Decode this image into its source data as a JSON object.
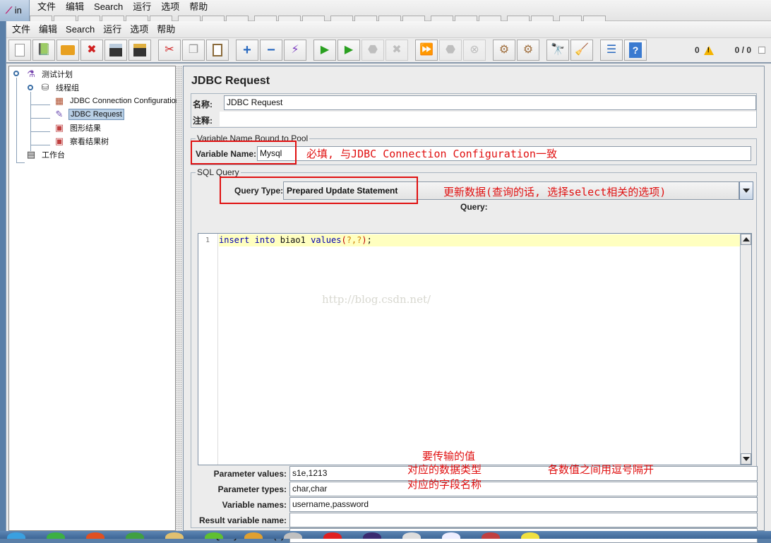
{
  "background_window": {
    "title_fragment": "in",
    "menu": [
      "文件",
      "编辑",
      "Search",
      "运行",
      "选项",
      "帮助"
    ]
  },
  "menubar": {
    "items": [
      "文件",
      "编辑",
      "Search",
      "运行",
      "选项",
      "帮助"
    ]
  },
  "toolbar": {
    "buttons": [
      {
        "name": "new",
        "icon": "new-file-icon"
      },
      {
        "name": "templates",
        "icon": "templates-icon"
      },
      {
        "name": "open",
        "icon": "open-folder-icon"
      },
      {
        "name": "close",
        "icon": "close-file-icon"
      },
      {
        "name": "save",
        "icon": "save-icon"
      },
      {
        "name": "save-as",
        "icon": "save-as-icon"
      },
      {
        "name": "cut",
        "icon": "scissors-icon"
      },
      {
        "name": "copy",
        "icon": "copy-icon"
      },
      {
        "name": "paste",
        "icon": "paste-icon"
      },
      {
        "name": "expand",
        "icon": "plus-icon"
      },
      {
        "name": "collapse",
        "icon": "minus-icon"
      },
      {
        "name": "toggle",
        "icon": "toggle-icon"
      },
      {
        "name": "start",
        "icon": "play-icon"
      },
      {
        "name": "start-no-pauses",
        "icon": "play-no-timers-icon"
      },
      {
        "name": "stop",
        "icon": "stop-icon",
        "disabled": true
      },
      {
        "name": "shutdown",
        "icon": "shutdown-icon",
        "disabled": true
      },
      {
        "name": "remote-start",
        "icon": "remote-start-icon"
      },
      {
        "name": "remote-stop",
        "icon": "remote-stop-icon",
        "disabled": true
      },
      {
        "name": "remote-shutdown",
        "icon": "remote-shutdown-icon",
        "disabled": true
      },
      {
        "name": "clear",
        "icon": "clear-icon"
      },
      {
        "name": "clear-all",
        "icon": "clear-all-icon"
      },
      {
        "name": "search",
        "icon": "binoculars-icon"
      },
      {
        "name": "reset-search",
        "icon": "broom-icon"
      },
      {
        "name": "function-helper",
        "icon": "function-list-icon"
      },
      {
        "name": "help",
        "icon": "help-book-icon"
      }
    ],
    "status": {
      "error_count": "0",
      "threads": "0 / 0"
    }
  },
  "tree": {
    "nodes": [
      {
        "label": "测试计划",
        "icon": "test-plan-flask-icon",
        "level": 0
      },
      {
        "label": "线程组",
        "icon": "thread-group-spool-icon",
        "level": 1
      },
      {
        "label": "JDBC Connection Configuration",
        "icon": "jdbc-config-icon",
        "level": 2
      },
      {
        "label": "JDBC Request",
        "icon": "pipette-sampler-icon",
        "level": 2,
        "selected": true
      },
      {
        "label": "图形结果",
        "icon": "graph-listener-icon",
        "level": 2
      },
      {
        "label": "察看结果树",
        "icon": "results-tree-listener-icon",
        "level": 2
      },
      {
        "label": "工作台",
        "icon": "workbench-icon",
        "level": 0
      }
    ]
  },
  "panel": {
    "title": "JDBC Request",
    "name_label": "名称:",
    "name_value": "JDBC Request",
    "comment_label": "注释:",
    "comment_value": "",
    "pool_group_title": "Variable Name Bound to Pool",
    "variable_name_label": "Variable Name:",
    "variable_name_value": "Mysql",
    "sql_group_title": "SQL Query",
    "query_type_label": "Query Type:",
    "query_type_value": "Prepared Update Statement",
    "query_label": "Query:",
    "query_line_number": "1",
    "query_code": {
      "kw1": "insert",
      "kw2": "into",
      "table": "biao1",
      "kw3": "values",
      "open": "(",
      "args": "?,?",
      "close": ")",
      "end": ";"
    },
    "params": [
      {
        "label": "Parameter values:",
        "value": "s1e,1213"
      },
      {
        "label": "Parameter types:",
        "value": "char,char"
      },
      {
        "label": "Variable names:",
        "value": "username,password"
      },
      {
        "label": "Result variable name:",
        "value": ""
      },
      {
        "label": "Query timeout (s):",
        "value": ""
      }
    ]
  },
  "annotations": {
    "variable_name_note": "必填, 与JDBC Connection Configuration一致",
    "query_type_note": "更新数据(查询的话, 选择select相关的选项)",
    "param_values_note": "要传输的值",
    "param_types_note": "对应的数据类型",
    "comma_note": "各数值之间用逗号隔开",
    "var_names_note": "对应的字段名称",
    "color": "#e01010"
  },
  "watermark": "http://blog.csdn.net/"
}
